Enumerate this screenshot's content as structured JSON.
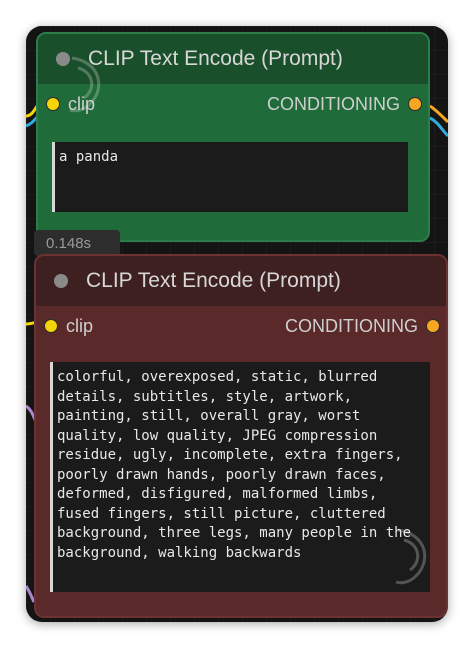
{
  "nodes": [
    {
      "title": "CLIP Text Encode (Prompt)",
      "input_label": "clip",
      "output_label": "CONDITIONING",
      "text": "a panda",
      "color": "#1f6b3a"
    },
    {
      "title": "CLIP Text Encode (Prompt)",
      "input_label": "clip",
      "output_label": "CONDITIONING",
      "text": "colorful, overexposed, static, blurred details, subtitles, style, artwork, painting, still, overall gray, worst quality, low quality, JPEG compression residue, ugly, incomplete, extra fingers, poorly drawn hands, poorly drawn faces, deformed, disfigured, malformed limbs, fused fingers, still picture, cluttered background, three legs, many people in the background, walking backwards",
      "color": "#5a2a2a"
    }
  ],
  "execution_time": "0.148s",
  "icons": {
    "collapse": "collapse-dot-icon",
    "input_slot": "clip-input-dot-icon",
    "output_slot": "conditioning-output-dot-icon",
    "watermark": "logo-watermark-icon"
  }
}
